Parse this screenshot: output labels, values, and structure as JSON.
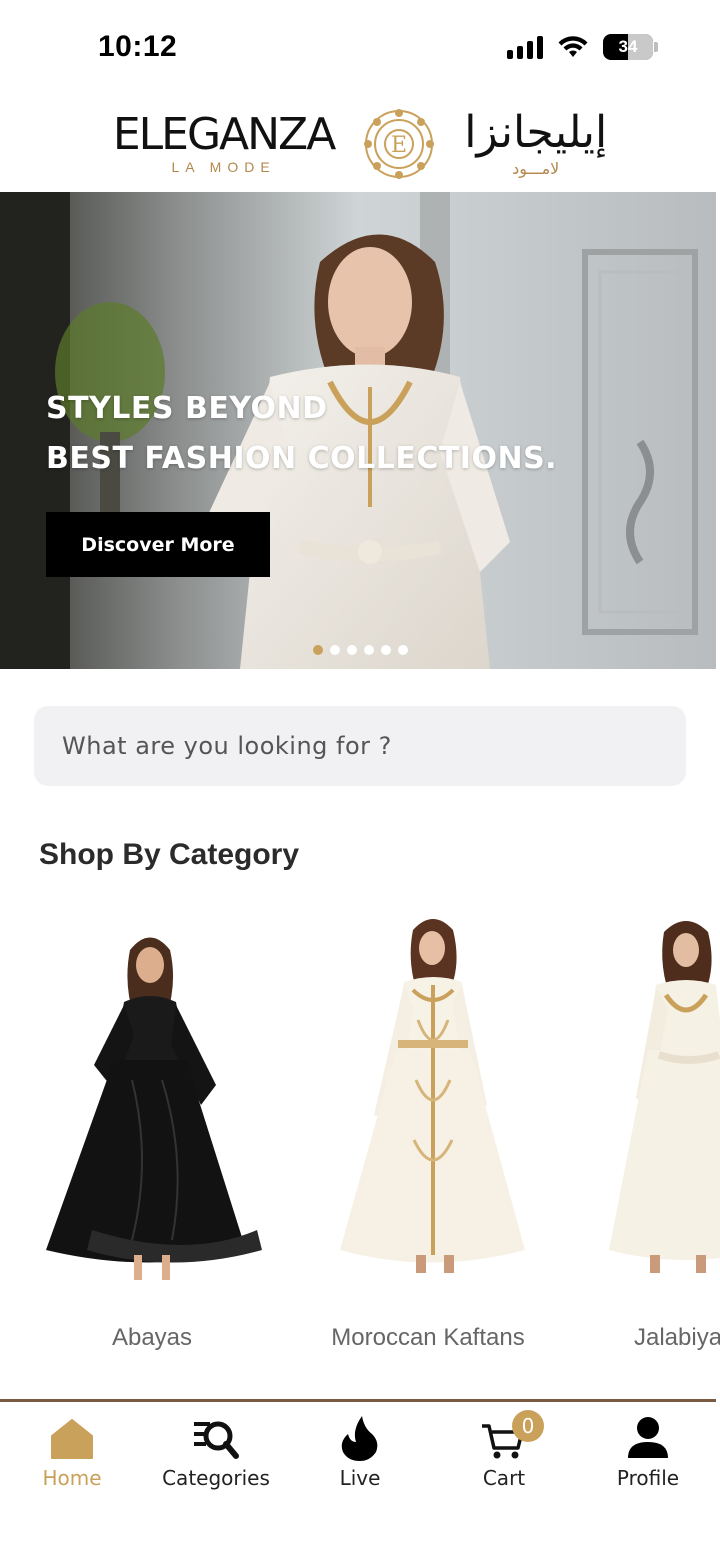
{
  "status_bar": {
    "time": "10:12",
    "battery": "34",
    "icons": [
      "signal-icon",
      "wifi-icon",
      "battery-icon"
    ]
  },
  "brand": {
    "name": "ELEGANZA",
    "tagline": "LA MODE",
    "arabic_name": "إيليجانزا",
    "arabic_tagline": "لامـــود",
    "emblem": "monogram-emblem-icon",
    "gold_color": "#c9a15a"
  },
  "hero": {
    "headline_line1": "STYLES BEYOND",
    "headline_line2": "BEST FASHION COLLECTIONS.",
    "cta_label": "Discover More",
    "slide_count": 6,
    "active_slide": 1
  },
  "search": {
    "placeholder": "What are you looking for ?",
    "value": ""
  },
  "categories": {
    "title": "Shop By Category",
    "items": [
      {
        "label": "Abayas"
      },
      {
        "label": "Moroccan Kaftans"
      },
      {
        "label": "Jalabiya"
      }
    ]
  },
  "bottom_nav": {
    "items": [
      {
        "label": "Home",
        "icon": "home-icon",
        "active": true
      },
      {
        "label": "Categories",
        "icon": "categories-search-icon",
        "active": false
      },
      {
        "label": "Live",
        "icon": "flame-icon",
        "active": false
      },
      {
        "label": "Cart",
        "icon": "cart-icon",
        "active": false,
        "badge": "0"
      },
      {
        "label": "Profile",
        "icon": "profile-icon",
        "active": false
      }
    ]
  }
}
